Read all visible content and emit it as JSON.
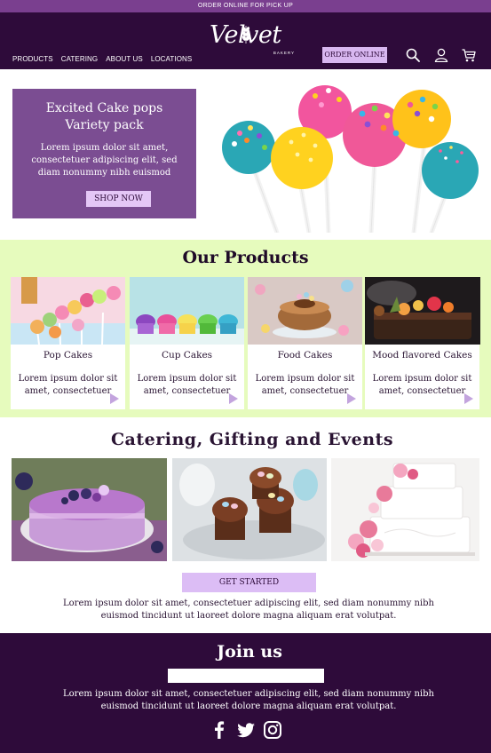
{
  "promo": {
    "text": "ORDER ONLINE FOR PICK UP"
  },
  "header": {
    "nav": [
      "PRODUCTS",
      "CATERING",
      "ABOUT US",
      "LOCATIONS"
    ],
    "logo": {
      "name": "Velvet",
      "sub": "BAKERY"
    },
    "order_label": "ORDER ONLINE",
    "icons": [
      "search-icon",
      "user-icon",
      "cart-icon"
    ]
  },
  "hero": {
    "title_line1": "Excited Cake pops",
    "title_line2": "Variety pack",
    "text": "Lorem ipsum dolor sit amet, consectetuer adipiscing elit, sed diam nonummy nibh euismod",
    "button": "SHOP NOW"
  },
  "products": {
    "title": "Our Products",
    "items": [
      {
        "title": "Pop Cakes",
        "text": "Lorem ipsum dolor sit amet, consectetuer"
      },
      {
        "title": "Cup Cakes",
        "text": "Lorem ipsum dolor sit amet, consectetuer"
      },
      {
        "title": "Food Cakes",
        "text": "Lorem ipsum dolor sit amet, consectetuer"
      },
      {
        "title": "Mood flavored Cakes",
        "text": "Lorem ipsum dolor sit amet, consectetuer"
      }
    ]
  },
  "catering": {
    "title": "Catering,  Gifting  and  Events",
    "button": "GET STARTED",
    "text": "Lorem ipsum dolor sit amet, consectetuer adipiscing elit, sed diam nonummy nibh euismod tincidunt ut laoreet dolore magna aliquam erat volutpat."
  },
  "footer": {
    "title": "Join us",
    "input_value": "",
    "text": "Lorem ipsum dolor sit amet, consectetuer adipiscing elit, sed diam nonummy nibh euismod tincidunt ut laoreet dolore magna aliquam erat volutpat.",
    "social": [
      "facebook-icon",
      "twitter-icon",
      "instagram-icon"
    ]
  },
  "colors": {
    "header_bg": "#2e0b3a",
    "promo_bg": "#7a3f8f",
    "accent_light": "#dcbdf5",
    "hero_card": "#7b4d92",
    "products_bg": "#e6fbbd"
  }
}
